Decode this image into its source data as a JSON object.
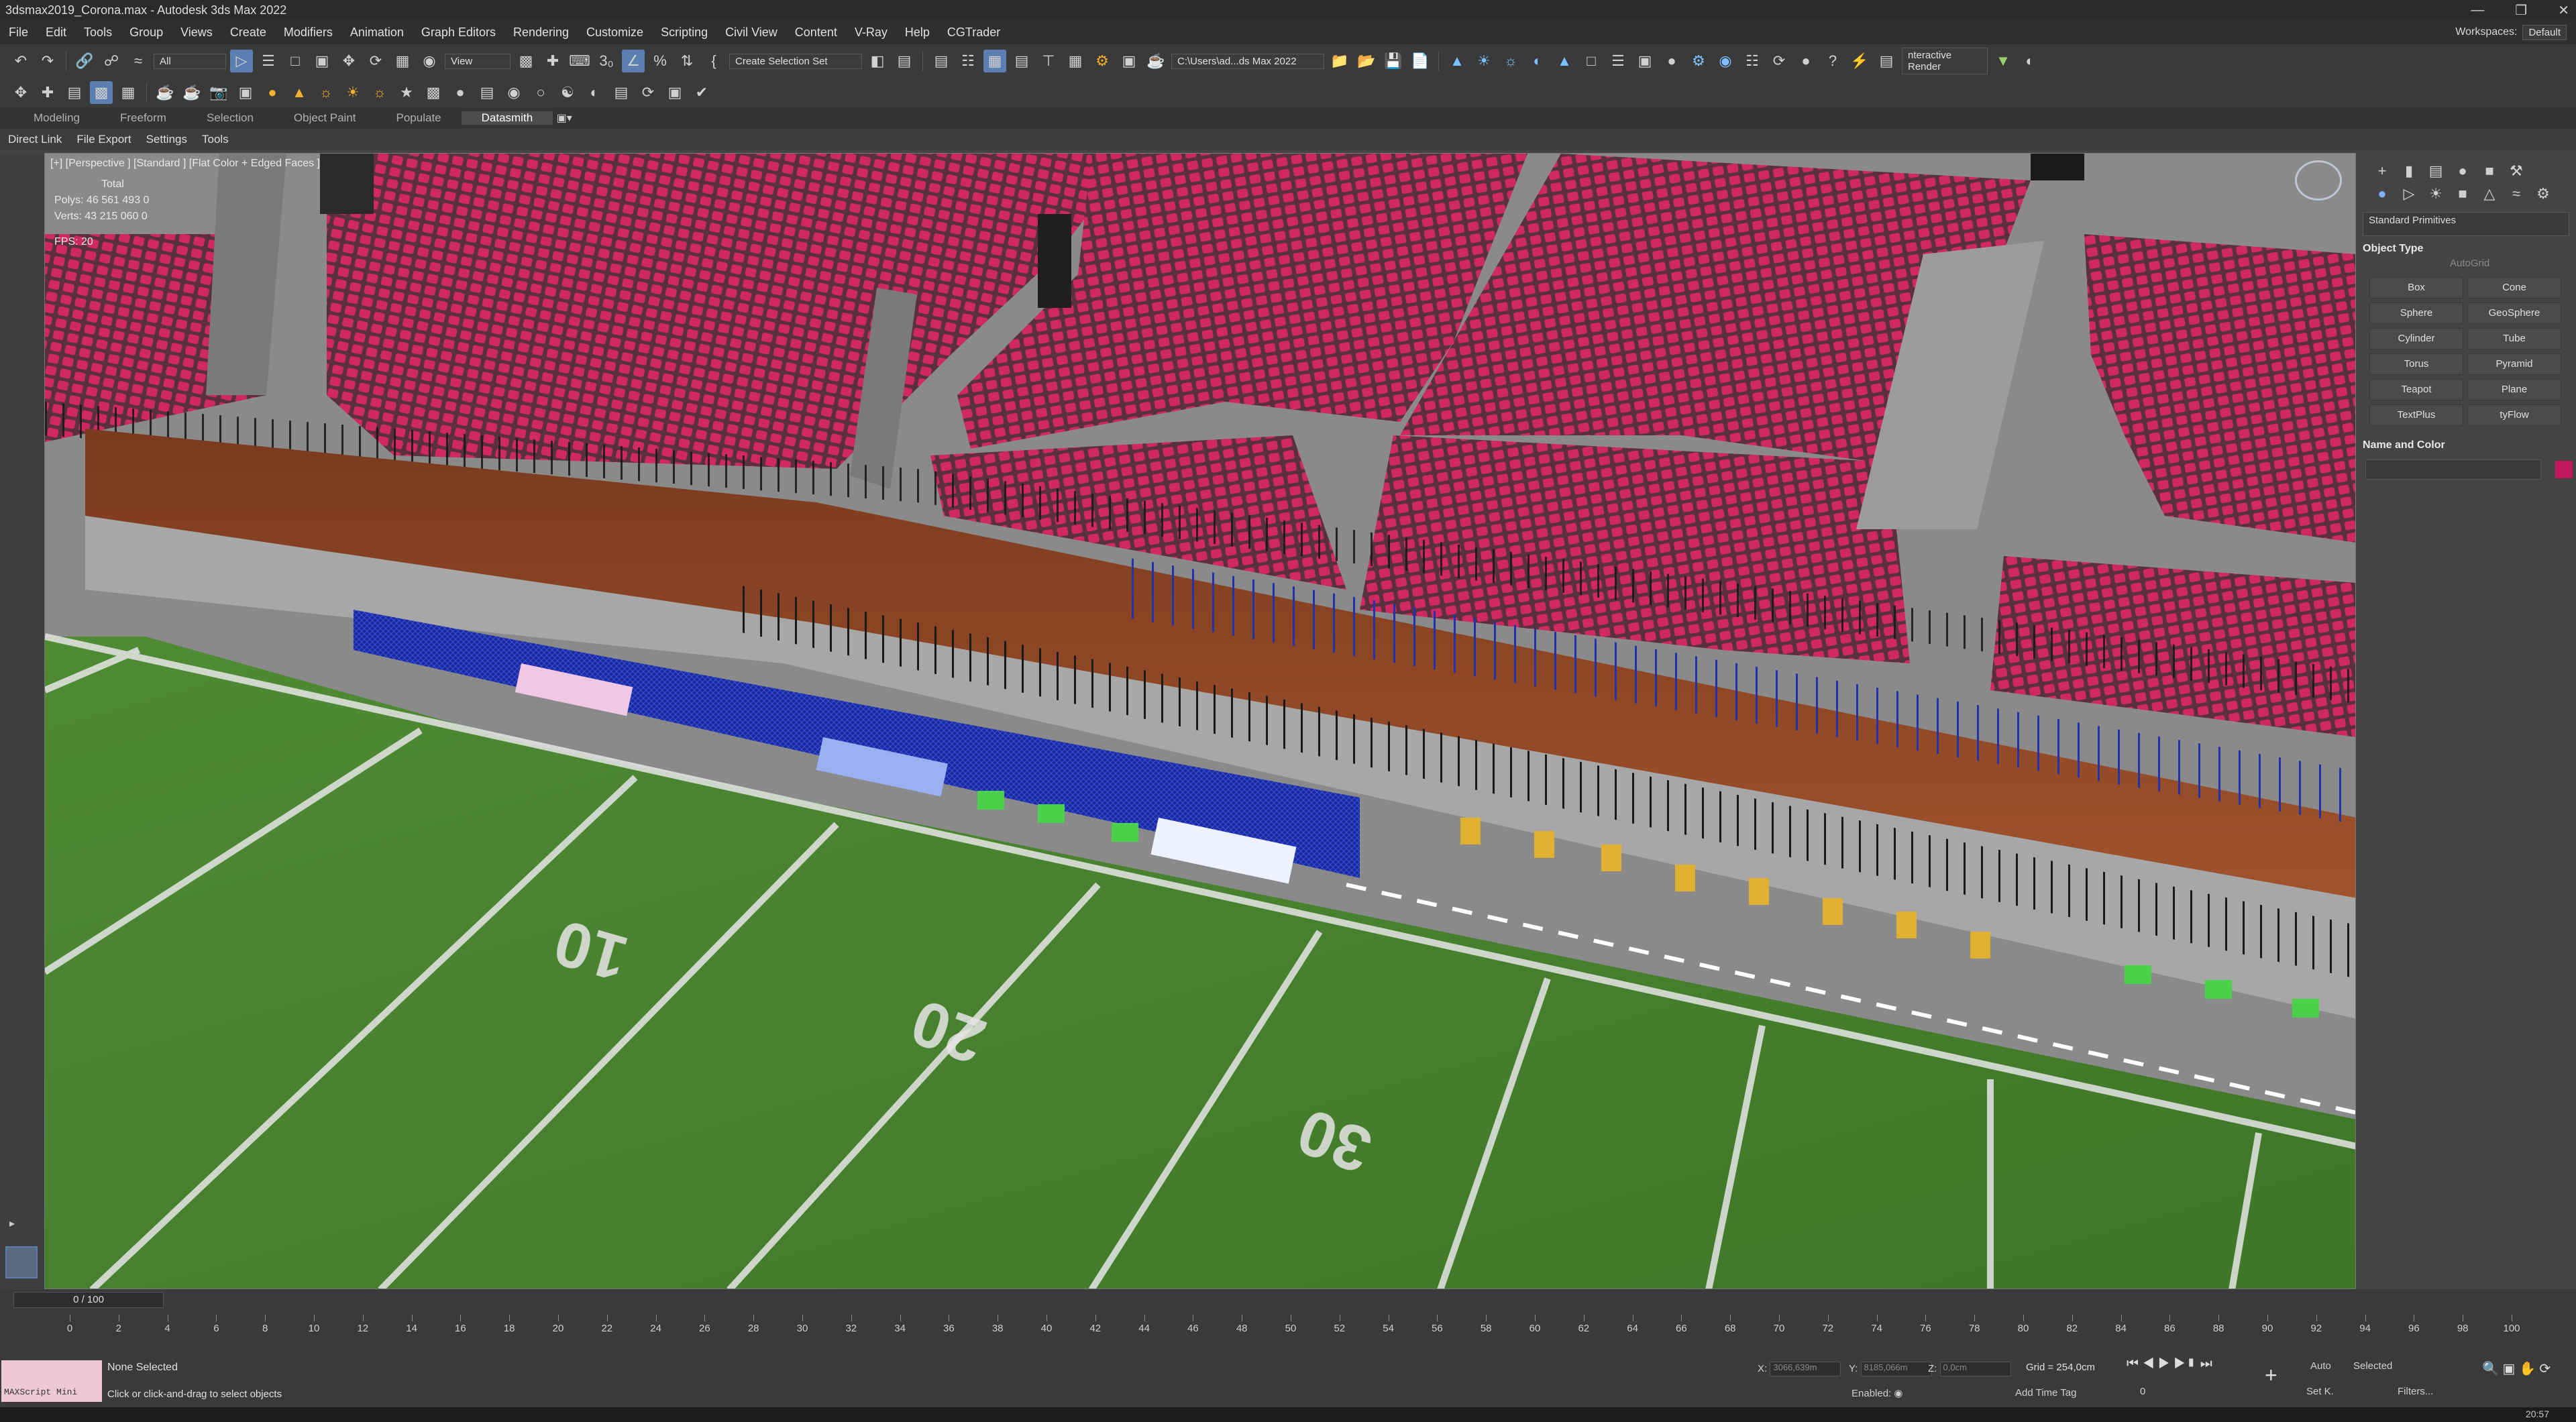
{
  "window": {
    "title": "3dsmax2019_Corona.max - Autodesk 3ds Max 2022"
  },
  "menu": {
    "items": [
      "File",
      "Edit",
      "Tools",
      "Group",
      "Views",
      "Create",
      "Modifiers",
      "Animation",
      "Graph Editors",
      "Rendering",
      "Customize",
      "Scripting",
      "Civil View",
      "Content",
      "V-Ray",
      "Help",
      "CGTrader"
    ],
    "workspaces_label": "Workspaces:",
    "workspaces_value": "Default"
  },
  "toolbar": {
    "selection_filter": "All",
    "view_dropdown": "View",
    "create_selection_set": "Create Selection Set",
    "project_path": "C:\\Users\\ad...ds Max 2022",
    "interactive_render": "nteractive Render"
  },
  "ribbon": {
    "tabs": [
      "Modeling",
      "Freeform",
      "Selection",
      "Object Paint",
      "Populate",
      "Datasmith"
    ],
    "active": "Datasmith",
    "subtabs": [
      "Direct Link",
      "File Export",
      "Settings",
      "Tools"
    ]
  },
  "viewport": {
    "label": "[+] [Perspective ] [Standard ] [Flat Color + Edged Faces ]",
    "stats": {
      "total_label": "Total",
      "polys": "Polys: 46 561 493  0",
      "verts": "Verts: 43 215 060  0",
      "fps": "FPS:   20"
    }
  },
  "command_panel": {
    "category": "Standard Primitives",
    "object_type_title": "Object Type",
    "autogrid": "AutoGrid",
    "primitives": [
      "Box",
      "Cone",
      "Sphere",
      "GeoSphere",
      "Cylinder",
      "Tube",
      "Torus",
      "Pyramid",
      "Teapot",
      "Plane",
      "TextPlus",
      "tyFlow"
    ],
    "name_color_title": "Name and Color",
    "object_color": "#c2185b"
  },
  "timeline": {
    "frame_display": "0 / 100",
    "ticks": [
      0,
      2,
      4,
      6,
      8,
      10,
      12,
      14,
      16,
      18,
      20,
      22,
      24,
      26,
      28,
      30,
      32,
      34,
      36,
      38,
      40,
      42,
      44,
      46,
      48,
      50,
      52,
      54,
      56,
      58,
      60,
      62,
      64,
      66,
      68,
      70,
      72,
      74,
      76,
      78,
      80,
      82,
      84,
      86,
      88,
      90,
      92,
      94,
      96,
      98,
      100
    ]
  },
  "status": {
    "selection": "None Selected",
    "prompt": "Click or click-and-drag to select objects",
    "maxscript": "MAXScript Mini",
    "x_label": "X:",
    "x_value": "3066,639m",
    "y_label": "Y:",
    "y_value": "8185,066m",
    "z_label": "Z:",
    "z_value": "0,0cm",
    "grid": "Grid = 254,0cm",
    "enabled_label": "Enabled:",
    "add_time_tag": "Add Time Tag",
    "auto_key": "Auto",
    "set_key": "Set K.",
    "key_mode": "Selected",
    "filters": "Filters...",
    "frame_spinner": "0",
    "clock": "20:57"
  }
}
